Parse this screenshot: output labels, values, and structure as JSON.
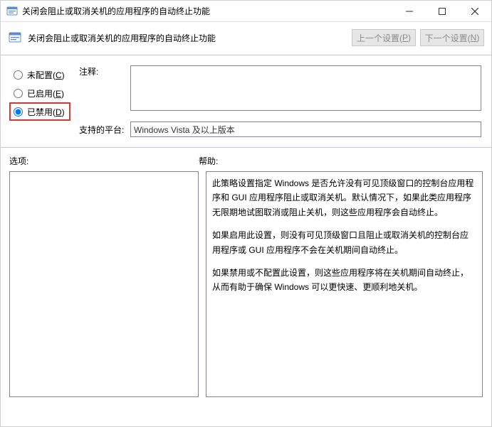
{
  "window": {
    "title": "关闭会阻止或取消关机的应用程序的自动终止功能"
  },
  "header": {
    "title": "关闭会阻止或取消关机的应用程序的自动终止功能",
    "prev_label_pre": "上一个设置(",
    "prev_accel": "P",
    "prev_label_post": ")",
    "next_label_pre": "下一个设置(",
    "next_accel": "N",
    "next_label_post": ")"
  },
  "radios": {
    "not_configured_pre": "未配置(",
    "not_configured_accel": "C",
    "not_configured_post": ")",
    "enabled_pre": "已启用(",
    "enabled_accel": "E",
    "enabled_post": ")",
    "disabled_pre": "已禁用(",
    "disabled_accel": "D",
    "disabled_post": ")"
  },
  "labels": {
    "comment": "注释:",
    "platform": "支持的平台:",
    "options": "选项:",
    "help": "帮助:"
  },
  "values": {
    "comment": "",
    "platform": "Windows Vista 及以上版本"
  },
  "help": {
    "p1": "此策略设置指定 Windows 是否允许没有可见顶级窗口的控制台应用程序和 GUI 应用程序阻止或取消关机。默认情况下，如果此类应用程序无限期地试图取消或阻止关机，则这些应用程序会自动终止。",
    "p2": "如果启用此设置，则没有可见顶级窗口且阻止或取消关机的控制台应用程序或 GUI 应用程序不会在关机期间自动终止。",
    "p3": "如果禁用或不配置此设置，则这些应用程序将在关机期间自动终止，从而有助于确保 Windows 可以更快速、更顺利地关机。"
  }
}
